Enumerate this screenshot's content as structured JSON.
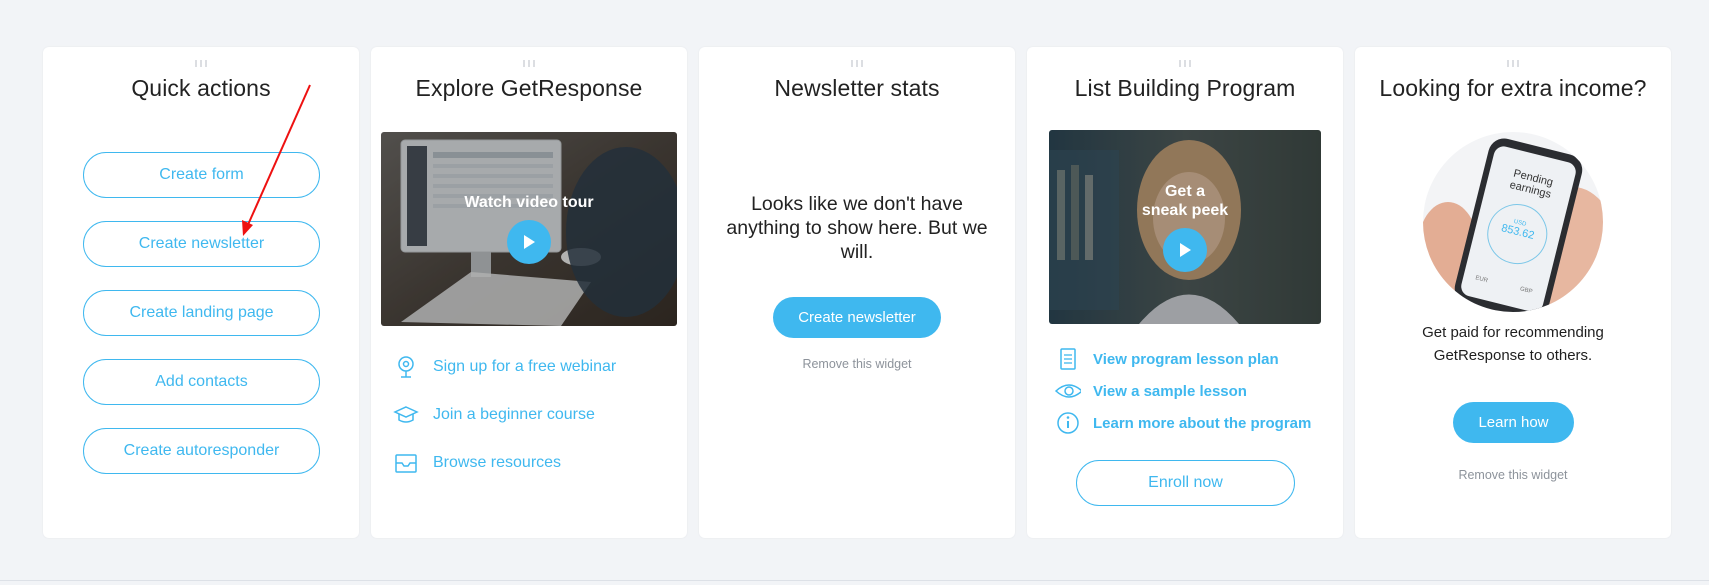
{
  "quick_actions": {
    "title": "Quick actions",
    "buttons": [
      "Create form",
      "Create newsletter",
      "Create landing page",
      "Add contacts",
      "Create autoresponder"
    ]
  },
  "explore": {
    "title": "Explore GetResponse",
    "video_caption": "Watch video tour",
    "links": [
      "Sign up for a free webinar",
      "Join a beginner course",
      "Browse resources"
    ],
    "link_icons": [
      "webinar-icon",
      "graduation-cap-icon",
      "inbox-icon"
    ]
  },
  "newsletter_stats": {
    "title": "Newsletter stats",
    "message": "Looks like we don't have anything to show here. But we will.",
    "button": "Create newsletter",
    "remove": "Remove this widget"
  },
  "list_building": {
    "title": "List Building Program",
    "video_caption_line1": "Get a",
    "video_caption_line2": "sneak peek",
    "links": [
      "View program lesson plan",
      "View a sample lesson",
      "Learn more about the program"
    ],
    "link_icons": [
      "document-icon",
      "eye-icon",
      "info-icon"
    ],
    "button": "Enroll now"
  },
  "extra_income": {
    "title": "Looking for extra income?",
    "phone_header": "Pending earnings",
    "phone_currency": "USD",
    "phone_amount": "853.62",
    "phone_bottom_left": "EUR",
    "phone_bottom_right": "GBP",
    "description": "Get paid for recommending GetResponse to others.",
    "button": "Learn how",
    "remove": "Remove this widget"
  },
  "colors": {
    "accent": "#3fb8ef",
    "background": "#f2f4f7",
    "arrow": "#ee1111"
  }
}
